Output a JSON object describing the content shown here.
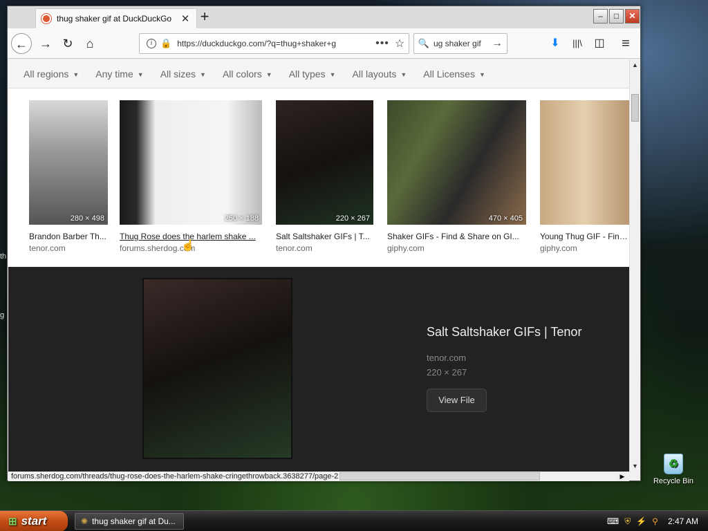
{
  "desktop": {
    "recycle_bin_label": "Recycle Bin",
    "edge_text_1": "th",
    "edge_text_2": "g"
  },
  "browser": {
    "tab_title": "thug shaker gif at DuckDuckGo",
    "tab_close": "✕",
    "new_tab": "+",
    "window_controls": {
      "minimize": "–",
      "maximize": "□",
      "close": "✕"
    },
    "nav": {
      "back": "←",
      "forward": "→",
      "reload": "↻",
      "home": "⌂"
    },
    "url": "https://duckduckgo.com/?q=thug+shaker+g",
    "url_more": "•••",
    "url_star": "☆",
    "search_value": "ug shaker gif",
    "search_go": "→",
    "toolbar_icons": {
      "download": "⬇",
      "library": "|||\\",
      "sidebar": "◫",
      "menu": "≡"
    }
  },
  "filters": [
    {
      "label": "All regions"
    },
    {
      "label": "Any time"
    },
    {
      "label": "All sizes"
    },
    {
      "label": "All colors"
    },
    {
      "label": "All types"
    },
    {
      "label": "All layouts"
    },
    {
      "label": "All Licenses"
    }
  ],
  "filter_caret": "▼",
  "results": [
    {
      "title": "Brandon Barber Th...",
      "source": "tenor.com",
      "dims": "280 × 498"
    },
    {
      "title": "Thug Rose does the harlem shake ...",
      "source": "forums.sherdog.com",
      "dims": "250 × 188"
    },
    {
      "title": "Salt Saltshaker GIFs | T...",
      "source": "tenor.com",
      "dims": "220 × 267"
    },
    {
      "title": "Shaker GIFs - Find & Share on GI...",
      "source": "giphy.com",
      "dims": "470 × 405"
    },
    {
      "title": "Young Thug GIF - Find &",
      "source": "giphy.com",
      "dims": ""
    }
  ],
  "detail": {
    "title": "Salt Saltshaker GIFs | Tenor",
    "source": "tenor.com",
    "dims": "220 × 267",
    "view_button": "View File"
  },
  "status_url": "forums.sherdog.com/threads/thug-rose-does-the-harlem-shake-cringethrowback.3638277/page-2",
  "taskbar": {
    "start_label": "start",
    "task_label": "thug shaker gif at Du...",
    "clock": "2:47 AM"
  },
  "colors": {
    "accent_orange": "#de5833",
    "detail_bg": "#222222",
    "download_blue": "#0a84ff"
  }
}
